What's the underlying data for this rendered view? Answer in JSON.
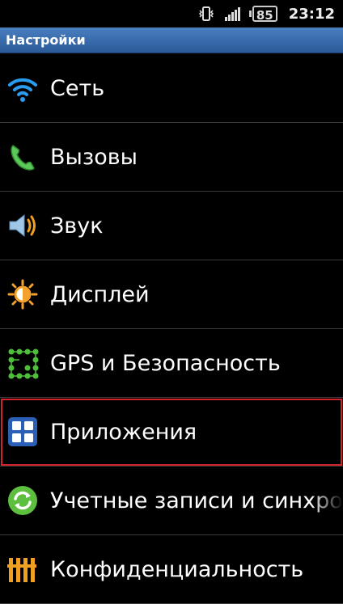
{
  "status_bar": {
    "battery_level": "85",
    "time": "23:12",
    "icons": [
      "vibrate-icon",
      "signal-icon",
      "battery-icon"
    ]
  },
  "title_bar": {
    "title": "Настройки"
  },
  "settings": {
    "items": [
      {
        "label": "Сеть",
        "icon": "wifi-icon",
        "selected": false
      },
      {
        "label": "Вызовы",
        "icon": "phone-icon",
        "selected": false
      },
      {
        "label": "Звук",
        "icon": "speaker-icon",
        "selected": false
      },
      {
        "label": "Дисплей",
        "icon": "brightness-icon",
        "selected": false
      },
      {
        "label": "GPS и Безопасность",
        "icon": "gps-security-icon",
        "selected": false
      },
      {
        "label": "Приложения",
        "icon": "apps-grid-icon",
        "selected": true
      },
      {
        "label": "Учетные записи и синхро",
        "icon": "sync-icon",
        "selected": false
      },
      {
        "label": "Конфиденциальность",
        "icon": "privacy-icon",
        "selected": false
      }
    ]
  },
  "colors": {
    "title_bar": "#3a6cb0",
    "selection_outline": "#d2232a",
    "divider": "#3a3a3a",
    "background": "#000000"
  }
}
